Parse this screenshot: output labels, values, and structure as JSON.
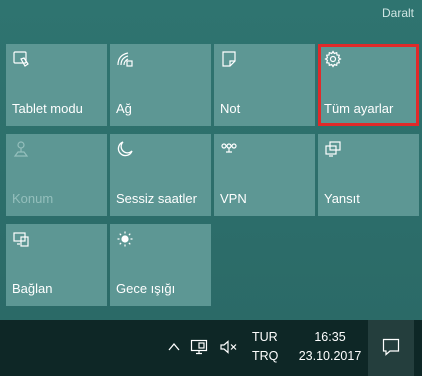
{
  "header": {
    "collapse_label": "Daralt"
  },
  "tiles": [
    {
      "label": "Tablet modu",
      "icon": "tablet-mode-icon",
      "enabled": true
    },
    {
      "label": "Ağ",
      "icon": "network-icon",
      "enabled": true
    },
    {
      "label": "Not",
      "icon": "note-icon",
      "enabled": true
    },
    {
      "label": "Tüm ayarlar",
      "icon": "gear-icon",
      "enabled": true,
      "highlighted": true
    },
    {
      "label": "Konum",
      "icon": "location-icon",
      "enabled": false
    },
    {
      "label": "Sessiz saatler",
      "icon": "moon-icon",
      "enabled": true
    },
    {
      "label": "VPN",
      "icon": "vpn-icon",
      "enabled": true
    },
    {
      "label": "Yansıt",
      "icon": "project-icon",
      "enabled": true
    },
    {
      "label": "Bağlan",
      "icon": "connect-icon",
      "enabled": true
    },
    {
      "label": "Gece ışığı",
      "icon": "brightness-icon",
      "enabled": true
    }
  ],
  "taskbar": {
    "language_primary": "TUR",
    "language_secondary": "TRQ",
    "time": "16:35",
    "date": "23.10.2017"
  },
  "colors": {
    "tile_bg": "#5d9794",
    "panel_bg": "#2c6d6a",
    "highlight": "#e02a2a",
    "taskbar_bg": "#0e2726"
  }
}
